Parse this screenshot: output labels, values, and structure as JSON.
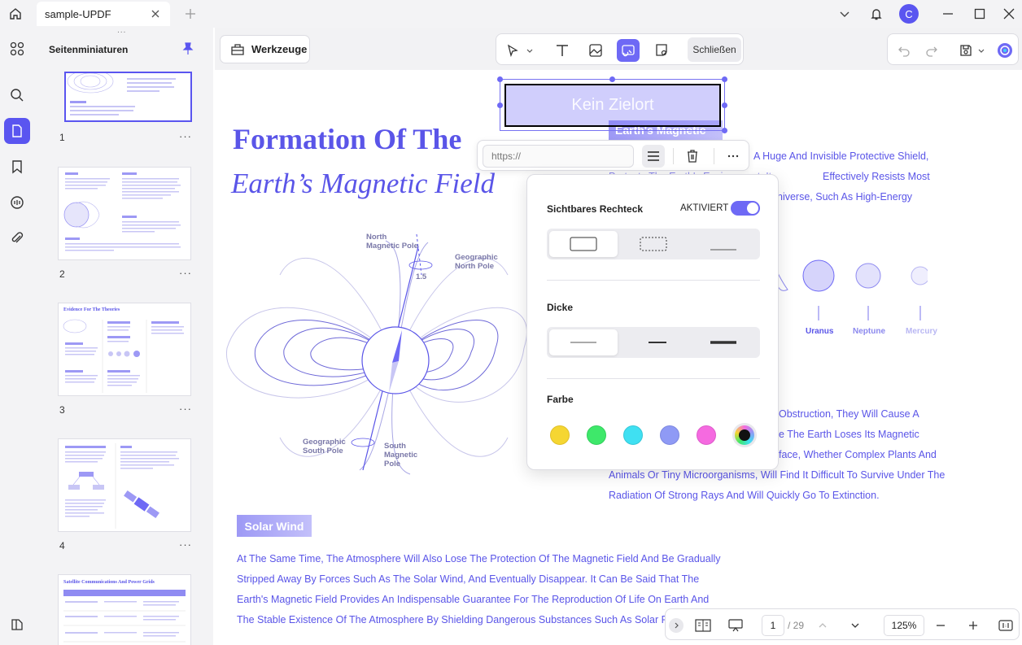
{
  "titlebar": {
    "tab_title": "sample-UPDF",
    "avatar_letter": "C"
  },
  "thumbnails": {
    "title": "Seitenminiaturen",
    "pages": [
      {
        "number": "1",
        "more": "···"
      },
      {
        "number": "2",
        "more": "···"
      },
      {
        "number": "3",
        "more": "···"
      },
      {
        "number": "4",
        "more": "···"
      }
    ],
    "page3_heading": "Evidence For The Theories",
    "page5_heading": "Satellite Communications And Power Grids"
  },
  "toolbar": {
    "tools_label": "Werkzeuge",
    "close_label": "Schließen"
  },
  "document": {
    "title_line1": "Formation Of The",
    "title_line2": "Earth’s Magnetic Field",
    "badge_earth": "Earth's Magnetic",
    "lines_right_top": [
      "A Huge And Invisible Protective Shield,",
      "Effectively Resists Most",
      "niverse, Such As High-Energy"
    ],
    "right_top_fragment": "Protects The Earth's Environment. It",
    "lines_right_mid": [
      "Obstruction, They Will Cause A",
      "e The Earth Loses Its Magnetic",
      "face, Whether Complex Plants And",
      "Animals Or Tiny Microorganisms, Will Find It Difficult To Survive Under The",
      "Radiation Of Strong Rays And Will Quickly Go To Extinction."
    ],
    "solar_wind_label": "Solar Wind",
    "lines_bottom": [
      "At The Same Time, The Atmosphere Will Also Lose The Protection Of The Magnetic Field And Be Gradually",
      "Stripped Away By Forces Such As The Solar Wind, And Eventually Disappear. It Can Be Said That The",
      "Earth's Magnetic Field Provides An Indispensable Guarantee For The Reproduction Of Life On Earth And",
      "The Stable Existence Of The Atmosphere By Shielding Dangerous Substances Such As Solar Particle"
    ],
    "planets": [
      {
        "name": "Uranus",
        "color": "#5a55e8"
      },
      {
        "name": "Neptune",
        "color": "#8b88ee"
      },
      {
        "name": "Mercury",
        "color": "#b9b7f3"
      }
    ],
    "diagram": {
      "north_magnetic": "North\nMagnetic Pole",
      "geographic_north": "Geographic\nNorth Pole",
      "geographic_south": "Geographic\nSouth Pole",
      "south_magnetic": "South\nMagnetic\nPole",
      "angle": "1.5"
    }
  },
  "link_annotation": {
    "text": "Kein Zielort",
    "url_placeholder": "https://"
  },
  "popover": {
    "visible_rect_label": "Sichtbares Rechteck",
    "visible_rect_state": "AKTIVIERT",
    "thickness_label": "Dicke",
    "color_label": "Farbe",
    "colors": [
      "#f5d632",
      "#3ee86a",
      "#3fe0f2",
      "#8f9af5",
      "#f56ae0",
      "#111111"
    ]
  },
  "bottombar": {
    "page_current": "1",
    "page_total": "/ 29",
    "zoom": "125%"
  }
}
